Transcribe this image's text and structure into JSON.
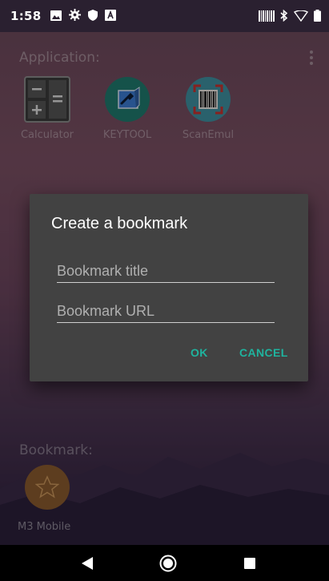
{
  "status_bar": {
    "time": "1:58",
    "left_icons": [
      "image-icon",
      "settings-icon",
      "shield-icon",
      "a-box-icon"
    ],
    "right_icons": [
      "barcode-icon",
      "bluetooth-icon",
      "wifi-icon",
      "battery-icon"
    ]
  },
  "launcher": {
    "application_label": "Application:",
    "apps": [
      {
        "label": "Calculator",
        "icon": "calculator-icon"
      },
      {
        "label": "KEYTOOL",
        "icon": "keytool-icon"
      },
      {
        "label": "ScanEmul",
        "icon": "barcode-scanner-icon"
      }
    ],
    "bookmark_label": "Bookmark:",
    "bookmarks": [
      {
        "label": "M3 Mobile",
        "icon": "star-icon"
      }
    ]
  },
  "dialog": {
    "title": "Create a bookmark",
    "title_placeholder": "Bookmark title",
    "url_placeholder": "Bookmark URL",
    "ok_label": "OK",
    "cancel_label": "CANCEL"
  },
  "colors": {
    "accent": "#1fb39e",
    "dialog_bg": "#424242",
    "status_bar_bg": "#2a2030"
  }
}
